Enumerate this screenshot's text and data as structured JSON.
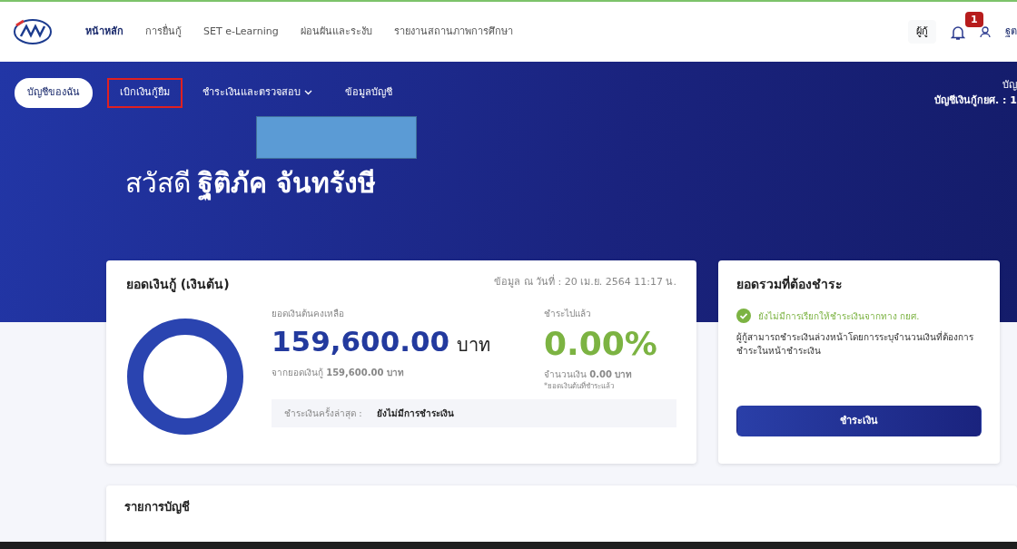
{
  "navbar": {
    "links": [
      {
        "label": "หน้าหลัก",
        "selected": true
      },
      {
        "label": "การยื่นกู้",
        "selected": false
      },
      {
        "label": "SET e-Learning",
        "selected": false
      },
      {
        "label": "ผ่อนผันและระงับ",
        "selected": false
      },
      {
        "label": "รายงานสถานภาพการศึกษา",
        "selected": false
      }
    ],
    "role_button": "ผู้กู้",
    "notification_count": "1",
    "user_name": "ฐต"
  },
  "subnav": {
    "tabs": [
      {
        "label": "บัญชีของฉัน",
        "selected": true,
        "highlighted": false,
        "dropdown": false
      },
      {
        "label": "เบิกเงินกู้ยืม",
        "selected": false,
        "highlighted": true,
        "dropdown": false
      },
      {
        "label": "ชำระเงินและตรวจสอบ",
        "selected": false,
        "highlighted": false,
        "dropdown": true
      },
      {
        "label": "ข้อมูลบัญชี",
        "selected": false,
        "highlighted": false,
        "dropdown": false
      }
    ],
    "account_top": "บัญ",
    "account_label": "บัญชีเงินกู้กยศ. : 1"
  },
  "greeting": {
    "hello": "สวัสดี",
    "name": "ฐิติภัค จันทรังษี"
  },
  "loan_card": {
    "title": "ยอดเงินกู้ (เงินต้น)",
    "as_of": "ข้อมูล ณ วันที่ : 20 เม.ย. 2564 11:17 น.",
    "remaining_label": "ยอดเงินต้นคงเหลือ",
    "remaining_amount": "159,600.00",
    "remaining_unit": "บาท",
    "from_total": "จากยอดเงินกู้ **159,600.00 บาท**",
    "paid_label": "ชำระไปแล้ว",
    "paid_percent": "0.00%",
    "paid_amount": "จำนวนเงิน **0.00 บาท**",
    "paid_note": "*ยอดเงินต้นที่ชำระแล้ว",
    "last_payment_label": "ชำระเงินครั้งล่าสุด :",
    "last_payment_value": "ยังไม่มีการชำระเงิน"
  },
  "due_card": {
    "title": "ยอดรวมที่ต้องชำระ",
    "status": "ยังไม่มีการเรียกให้ชำระเงินจากทาง กยศ.",
    "description": "ผู้กู้สามารถชำระเงินล่วงหน้าโดยการระบุจำนวนเงินที่ต้องการชำระในหน้าชำระเงิน",
    "pay_button": "ชำระเงิน"
  },
  "accounts_card": {
    "title": "รายการบัญชี"
  }
}
